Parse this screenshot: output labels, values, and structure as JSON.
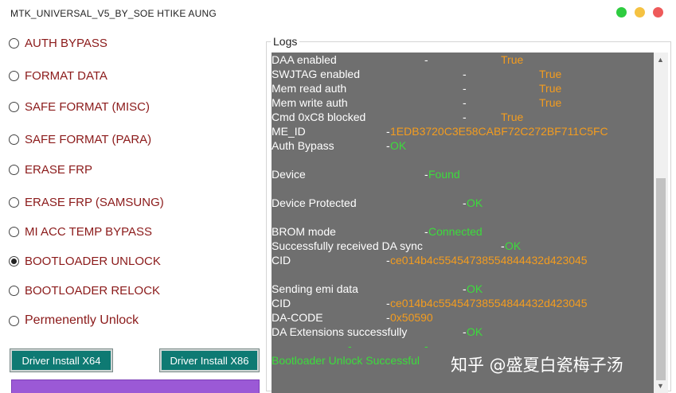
{
  "window": {
    "title": "MTK_UNIVERSAL_V5_BY_SOE HTIKE AUNG",
    "controls": {
      "colors": [
        "#2ecc40",
        "#f5c242",
        "#ee5a5a"
      ]
    }
  },
  "options": [
    {
      "label": "AUTH BYPASS",
      "selected": false
    },
    {
      "label": "FORMAT DATA",
      "selected": false
    },
    {
      "label": "SAFE FORMAT (MISC)",
      "selected": false
    },
    {
      "label": "SAFE FORMAT (PARA)",
      "selected": false
    },
    {
      "label": "ERASE FRP",
      "selected": false
    },
    {
      "label": "ERASE FRP (SAMSUNG)",
      "selected": false
    },
    {
      "label": "MI ACC TEMP BYPASS",
      "selected": false
    },
    {
      "label": "BOOTLOADER UNLOCK",
      "selected": true
    },
    {
      "label": "BOOTLOADER RELOCK",
      "selected": false
    },
    {
      "label": "Permenently Unlock",
      "selected": false
    }
  ],
  "buttons": {
    "driver_x64": "Driver Install X64",
    "driver_x86": "Driver Install X86"
  },
  "logs": {
    "title": "Logs",
    "lines": [
      {
        "key": "DAA enabled",
        "dash": "-",
        "value": "True",
        "color": "orange"
      },
      {
        "key": "SWJTAG enabled",
        "dash": "-",
        "value": "True",
        "color": "orange"
      },
      {
        "key": "Mem read auth",
        "dash": "-",
        "value": "True",
        "color": "orange"
      },
      {
        "key": "Mem write auth",
        "dash": "-",
        "value": "True",
        "color": "orange"
      },
      {
        "key": "Cmd 0xC8 blocked",
        "dash": "-",
        "value": "True",
        "color": "orange"
      },
      {
        "key": "ME_ID",
        "dash": "-",
        "value": "1EDB3720C3E58CABF72C272BF711C5FC",
        "color": "orange"
      },
      {
        "key": "Auth Bypass",
        "dash": "-",
        "value": "OK",
        "color": "green"
      },
      {
        "key": "Device",
        "dash": "-",
        "value": "Found",
        "color": "green"
      },
      {
        "key": "Device Protected",
        "dash": "-",
        "value": "OK",
        "color": "green"
      },
      {
        "key": "BROM mode",
        "dash": "-",
        "value": "Connected",
        "color": "green"
      },
      {
        "key": "Successfully received DA sync",
        "dash": "-",
        "value": "OK",
        "color": "green"
      },
      {
        "key": "CID",
        "dash": "-",
        "value": "ce014b4c55454738554844432d423045",
        "color": "orange"
      },
      {
        "key": "Sending emi data",
        "dash": "-",
        "value": "OK",
        "color": "green"
      },
      {
        "key": "CID",
        "dash": "-",
        "value": "ce014b4c55454738554844432d423045",
        "color": "orange"
      },
      {
        "key": "DA-CODE",
        "dash": "-",
        "value": " 0x50590",
        "color": "orange"
      },
      {
        "key": "DA Extensions successfully",
        "dash": "-",
        "value": "OK",
        "color": "green"
      },
      {
        "key": "",
        "dash": "-",
        "value": "-",
        "color": "green"
      },
      {
        "key": "",
        "dash": "",
        "value": "Bootloader Unlock Successful",
        "color": "green"
      }
    ]
  },
  "watermark": "知乎 @盛夏白瓷梅子汤"
}
